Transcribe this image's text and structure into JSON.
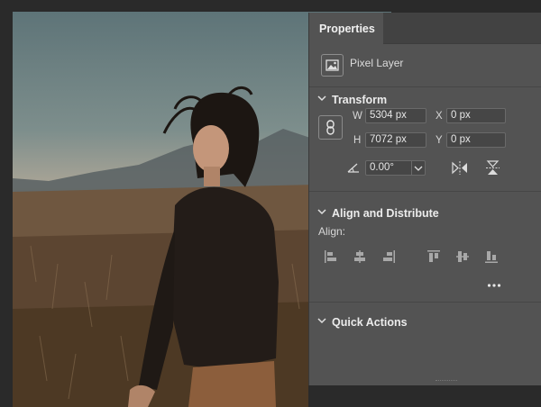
{
  "panel": {
    "tab_label": "Properties",
    "layer_type": "Pixel Layer",
    "transform": {
      "title": "Transform",
      "w_label": "W",
      "w_value": "5304 px",
      "h_label": "H",
      "h_value": "7072 px",
      "x_label": "X",
      "x_value": "0 px",
      "y_label": "Y",
      "y_value": "0 px",
      "angle_value": "0.00°"
    },
    "align": {
      "title": "Align and Distribute",
      "align_label": "Align:",
      "more_label": "..."
    },
    "quick_actions": {
      "title": "Quick Actions"
    }
  },
  "icons": [
    "pixel-layer-icon",
    "link-icon",
    "angle-icon",
    "flip-horizontal-icon",
    "flip-vertical-icon",
    "align-left-icon",
    "align-center-horizontal-icon",
    "align-right-icon",
    "align-top-icon",
    "align-middle-vertical-icon",
    "align-bottom-icon",
    "more-icon"
  ],
  "colors": {
    "panel_bg": "#535353",
    "tab_bar_bg": "#424242",
    "field_bg": "#464646",
    "canvas_bg": "#2a2a2a"
  }
}
